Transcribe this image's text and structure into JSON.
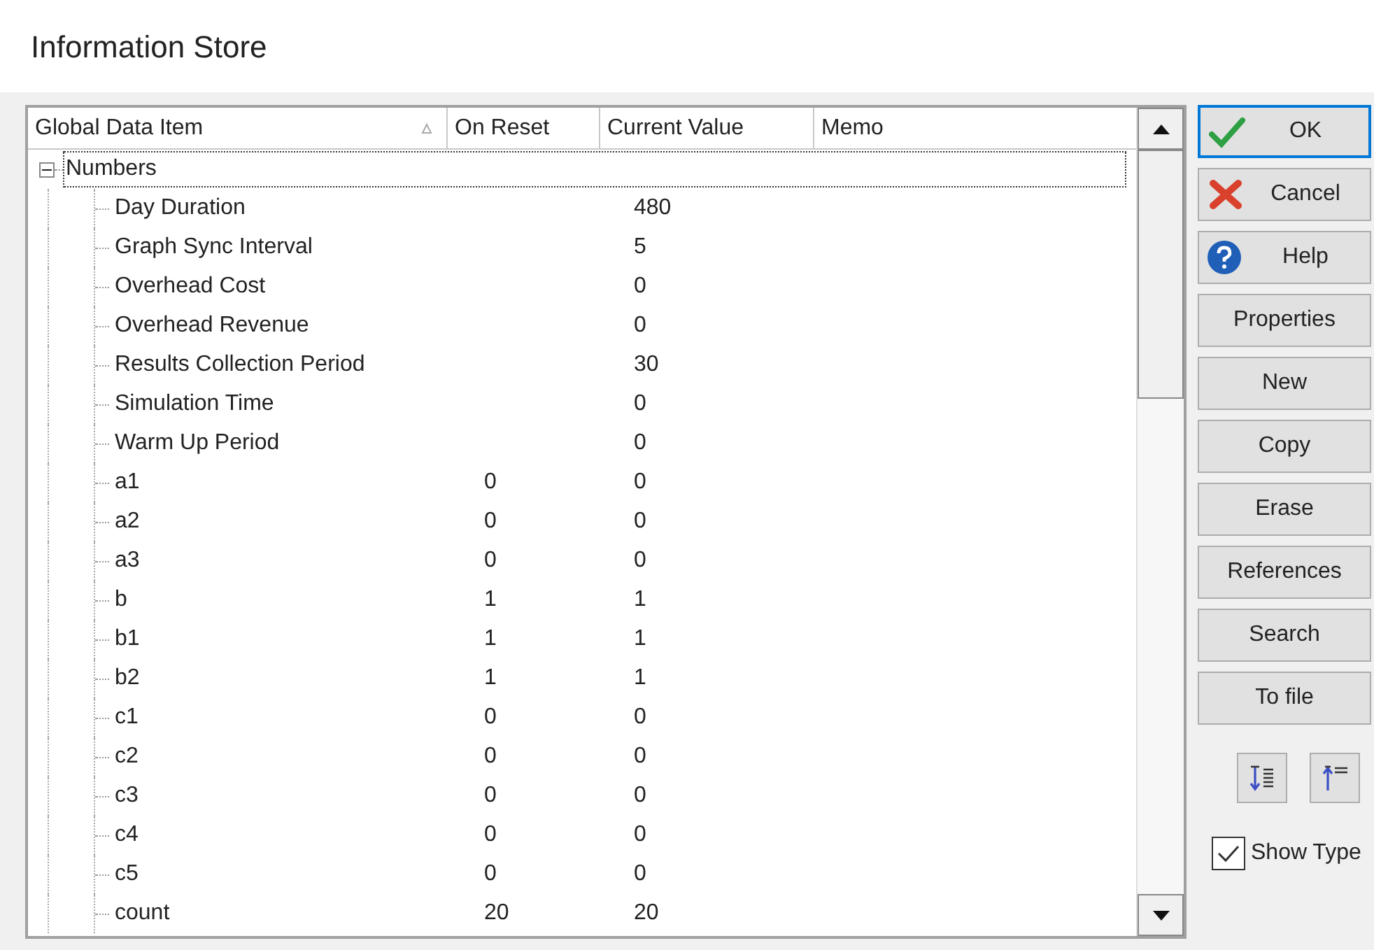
{
  "window": {
    "title": "Information Store"
  },
  "table": {
    "columns": [
      "Global Data Item",
      "On Reset",
      "Current Value",
      "Memo"
    ],
    "tree": [
      {
        "label": "Numbers",
        "expanded": true,
        "selected": true,
        "children": [
          {
            "name": "Day Duration",
            "current_value": "480"
          },
          {
            "name": "Graph Sync Interval",
            "current_value": "5"
          },
          {
            "name": "Overhead Cost",
            "current_value": "0"
          },
          {
            "name": "Overhead Revenue",
            "current_value": "0"
          },
          {
            "name": "Results Collection Period",
            "current_value": "30"
          },
          {
            "name": "Simulation Time",
            "current_value": "0"
          },
          {
            "name": "Warm Up Period",
            "current_value": "0"
          },
          {
            "name": "a1",
            "on_reset": "0",
            "current_value": "0"
          },
          {
            "name": "a2",
            "on_reset": "0",
            "current_value": "0"
          },
          {
            "name": "a3",
            "on_reset": "0",
            "current_value": "0"
          },
          {
            "name": "b",
            "on_reset": "1",
            "current_value": "1"
          },
          {
            "name": "b1",
            "on_reset": "1",
            "current_value": "1"
          },
          {
            "name": "b2",
            "on_reset": "1",
            "current_value": "1"
          },
          {
            "name": "c1",
            "on_reset": "0",
            "current_value": "0"
          },
          {
            "name": "c2",
            "on_reset": "0",
            "current_value": "0"
          },
          {
            "name": "c3",
            "on_reset": "0",
            "current_value": "0"
          },
          {
            "name": "c4",
            "on_reset": "0",
            "current_value": "0"
          },
          {
            "name": "c5",
            "on_reset": "0",
            "current_value": "0"
          },
          {
            "name": "count",
            "on_reset": "20",
            "current_value": "20"
          }
        ]
      }
    ]
  },
  "buttons": [
    {
      "label": "OK",
      "kind": "ok",
      "selected": true
    },
    {
      "label": "Cancel",
      "kind": "cancel",
      "selected": false
    },
    {
      "label": "Help",
      "kind": "help",
      "selected": false
    },
    {
      "label": "Properties",
      "kind": "plain",
      "selected": false
    },
    {
      "label": "New",
      "kind": "plain",
      "selected": false
    },
    {
      "label": "Copy",
      "kind": "plain",
      "selected": false
    },
    {
      "label": "Erase",
      "kind": "plain",
      "selected": false
    },
    {
      "label": "References",
      "kind": "plain",
      "selected": false
    },
    {
      "label": "Search",
      "kind": "plain",
      "selected": false
    },
    {
      "label": "To file",
      "kind": "plain",
      "selected": false
    }
  ],
  "tool_buttons": [
    {
      "kind": "expand"
    },
    {
      "kind": "collapse"
    }
  ],
  "show_type": {
    "label": "Show Type",
    "checked": true
  }
}
